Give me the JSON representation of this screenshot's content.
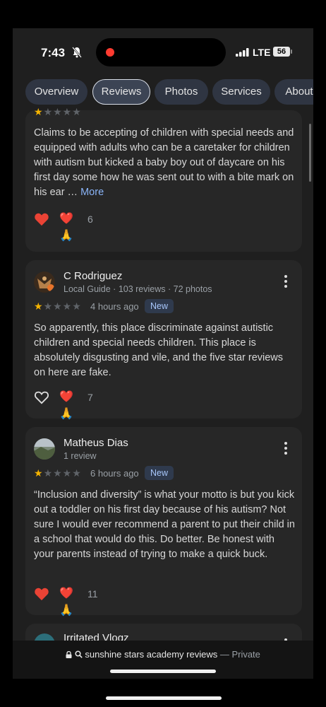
{
  "status": {
    "time": "7:43",
    "network": "LTE",
    "battery": "56"
  },
  "tabs": [
    {
      "label": "Overview",
      "active": false
    },
    {
      "label": "Reviews",
      "active": true
    },
    {
      "label": "Photos",
      "active": false
    },
    {
      "label": "Services",
      "active": false
    },
    {
      "label": "About",
      "active": false
    }
  ],
  "reviews": [
    {
      "rating": 1,
      "body": "Claims to be accepting of children with special needs and equipped with adults who can be a caretaker for children with autism but kicked a baby boy out of daycare on his first day some how he was sent out to with a bite mark on his ear …",
      "more_label": "More",
      "liked": true,
      "reaction_icons": "❤️🙏",
      "reaction_count": "6"
    },
    {
      "author": "C Rodriguez",
      "meta": "Local Guide · 103 reviews · 72 photos",
      "rating": 1,
      "ago": "4 hours ago",
      "badge": "New",
      "body": "So apparently, this place discriminate against autistic children and special needs children. This place is absolutely disgusting and vile, and the five star reviews on here are fake.",
      "liked": false,
      "reaction_icons": "❤️🙏",
      "reaction_count": "7"
    },
    {
      "author": "Matheus Dias",
      "meta": "1 review",
      "rating": 1,
      "ago": "6 hours ago",
      "badge": "New",
      "body": "“Inclusion and diversity” is what your motto is but you kick out a toddler on his first day because of his autism? Not sure I would ever recommend a parent to put their child in a school that would do this. Do better. Be honest with your parents instead of trying to make a quick buck.",
      "liked": true,
      "reaction_icons": "❤️🙏",
      "reaction_count": "11"
    },
    {
      "author": "Irritated Vlogz"
    }
  ],
  "browser": {
    "query": "sunshine stars academy reviews",
    "suffix": "— Private"
  },
  "colors": {
    "star": "#f5b400",
    "heart": "#ea4335",
    "link": "#8ab4f8",
    "badge_bg": "#2f3a4d"
  }
}
